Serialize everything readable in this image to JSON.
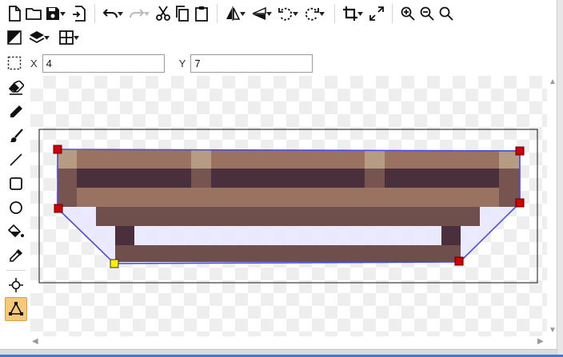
{
  "toolbar": {
    "row1": [
      {
        "name": "new-file-button",
        "icon": "new-file-icon"
      },
      {
        "name": "open-file-button",
        "icon": "folder-icon"
      },
      {
        "name": "save-button",
        "icon": "save-icon",
        "menu": true
      },
      {
        "name": "export-button",
        "icon": "export-icon"
      },
      {
        "name": "undo-button",
        "icon": "undo-icon",
        "menu": true
      },
      {
        "name": "redo-button",
        "icon": "redo-icon",
        "menu": true,
        "disabled": true
      },
      {
        "name": "cut-button",
        "icon": "scissors-icon"
      },
      {
        "name": "copy-button",
        "icon": "copy-icon"
      },
      {
        "name": "paste-button",
        "icon": "clipboard-icon"
      },
      {
        "name": "flip-horizontal-button",
        "icon": "flip-horizontal-icon",
        "menu": true
      },
      {
        "name": "flip-vertical-button",
        "icon": "flip-vertical-icon",
        "menu": true
      },
      {
        "name": "rotate-left-button",
        "icon": "rotate-left-icon",
        "menu": true
      },
      {
        "name": "rotate-right-button",
        "icon": "rotate-right-icon",
        "menu": true
      },
      {
        "name": "crop-button",
        "icon": "crop-icon",
        "menu": true
      },
      {
        "name": "resize-button",
        "icon": "expand-icon"
      },
      {
        "name": "zoom-in-button",
        "icon": "zoom-in-icon"
      },
      {
        "name": "zoom-out-button",
        "icon": "zoom-out-icon"
      },
      {
        "name": "zoom-fit-button",
        "icon": "magnifier-icon"
      }
    ],
    "row2": [
      {
        "name": "color-mode-button",
        "icon": "contrast-icon"
      },
      {
        "name": "layers-button",
        "icon": "layers-icon",
        "menu": true
      },
      {
        "name": "grid-button",
        "icon": "grid-icon",
        "menu": true
      }
    ]
  },
  "coords": {
    "x_label": "X",
    "x_value": "4",
    "y_label": "Y",
    "y_value": "7"
  },
  "tools": [
    {
      "name": "eraser-tool",
      "icon": "eraser-icon"
    },
    {
      "name": "pencil-tool",
      "icon": "pencil-icon"
    },
    {
      "name": "brush-tool",
      "icon": "brush-icon"
    },
    {
      "name": "line-tool",
      "icon": "line-icon"
    },
    {
      "name": "rectangle-tool",
      "icon": "rectangle-icon"
    },
    {
      "name": "ellipse-tool",
      "icon": "ellipse-icon"
    },
    {
      "name": "fill-tool",
      "icon": "paint-bucket-icon"
    },
    {
      "name": "eyedropper-tool",
      "icon": "eyedropper-icon"
    },
    {
      "name": "crosshair-tool",
      "icon": "crosshair-icon"
    },
    {
      "name": "polygon-select-tool",
      "icon": "polygon-select-icon",
      "active": true
    }
  ],
  "colors": {
    "accent_active": "#f4c97a",
    "selection_line": "#4a4ae0",
    "handle_red": "#d40000",
    "handle_yellow": "#ffee00",
    "pixel_light_brown": "#9a7262",
    "pixel_tan": "#b59c82",
    "pixel_dark_purple": "#4a2f3c",
    "pixel_mid_brown": "#785451",
    "pixel_shadow": "#6e4f4b",
    "selection_fill": "#e8e6ff"
  }
}
